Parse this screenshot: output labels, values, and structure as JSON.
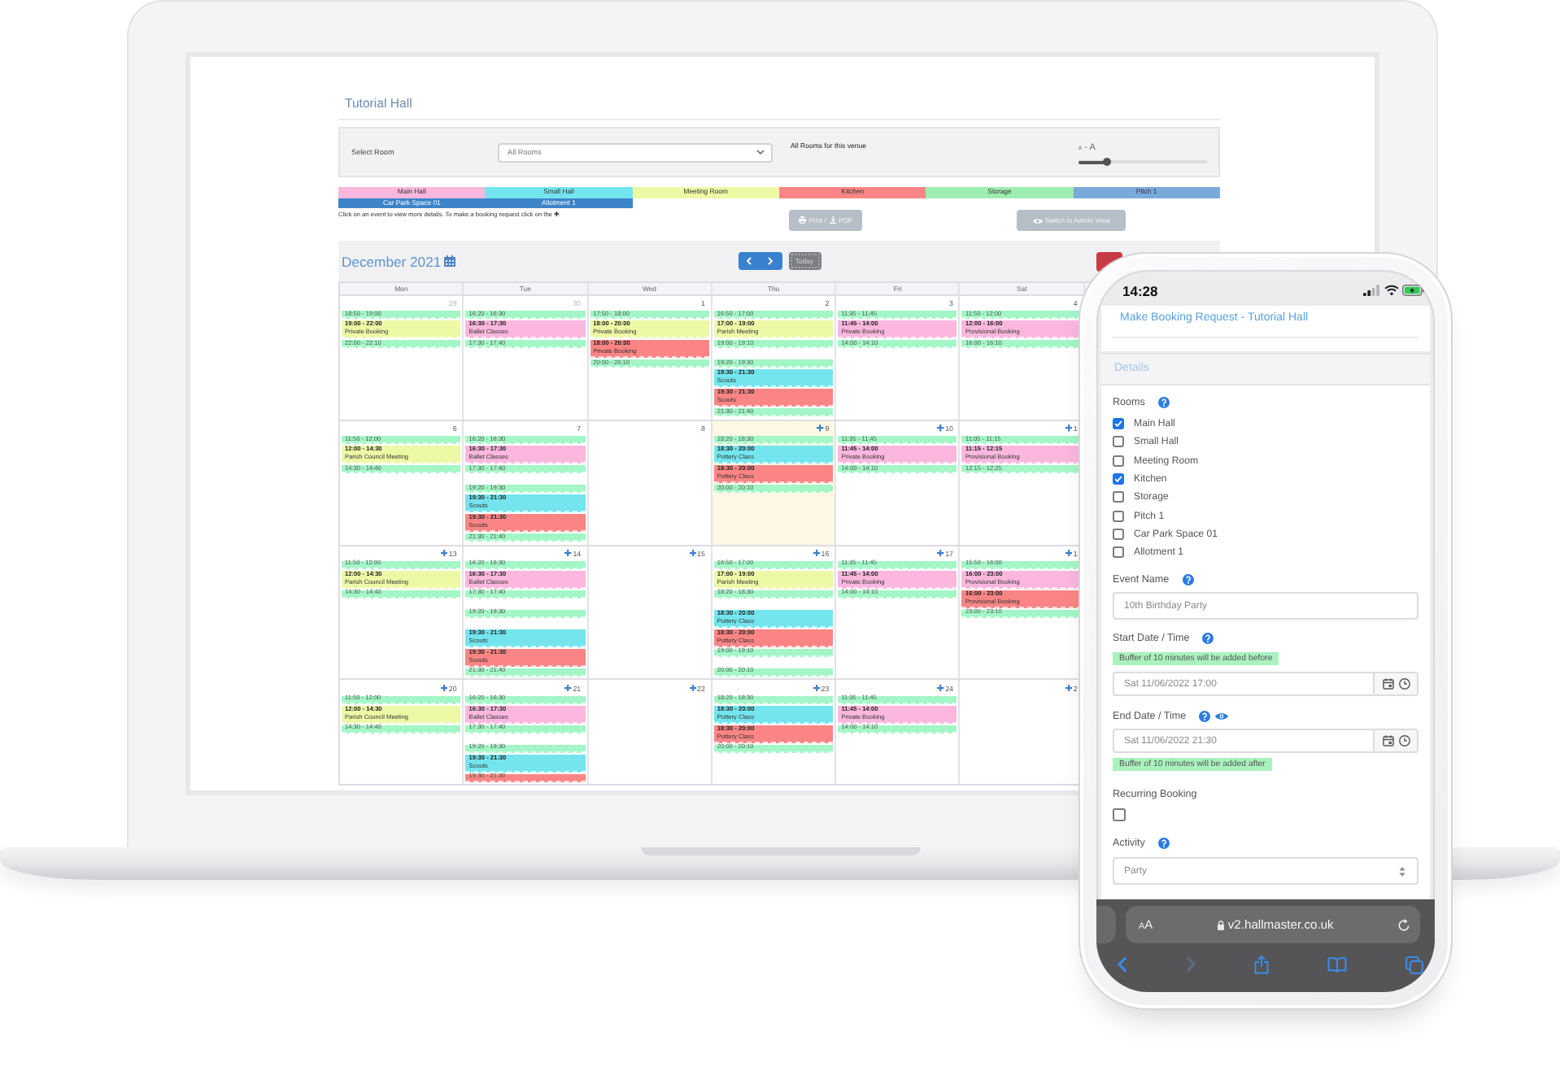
{
  "laptop": {
    "page_title": "Tutorial Hall",
    "filter": {
      "label": "Select Room",
      "select_value": "All Rooms",
      "note": "All Rooms for this venue",
      "slider": {
        "label": "A - A",
        "level": 0.22
      }
    },
    "legend": [
      {
        "name": "Main Hall",
        "color": "#fbb7de"
      },
      {
        "name": "Small Hall",
        "color": "#74e5ee"
      },
      {
        "name": "Meeting Room",
        "color": "#eef9a6"
      },
      {
        "name": "Kitchen",
        "color": "#fb8585"
      },
      {
        "name": "Storage",
        "color": "#9eeeb1"
      },
      {
        "name": "Pitch 1",
        "color": "#7aa9dc"
      },
      {
        "name": "Car Park Space 01",
        "color": "#3d84c9"
      },
      {
        "name": "Allotment 1",
        "color": "#3d84c9"
      }
    ],
    "hint": "Click on an event to view more details. To make a booking request click on the ✚.",
    "print_button": [
      "Print /",
      "PDF"
    ],
    "admin_button": "Switch to Admin View",
    "calendar": {
      "title": "December 2021",
      "today_button": {
        "label": "Today",
        "disabled": true
      },
      "weekdays": [
        "Mon",
        "Tue",
        "Wed",
        "Thu",
        "Fri",
        "Sat"
      ],
      "weeks": [
        {
          "days": [
            {
              "date": "29",
              "other_month": true,
              "today": false,
              "bookable": false,
              "events": [
                {
                  "time": "18:50 - 19:00",
                  "color": "#a3f6c6"
                },
                {
                  "time": "19:00 - 22:00",
                  "title": "Private Booking",
                  "color": "#eef9a6"
                },
                {
                  "time": "22:00 - 22:10",
                  "color": "#a3f6c6"
                }
              ]
            },
            {
              "date": "30",
              "other_month": true,
              "today": false,
              "bookable": false,
              "events": [
                {
                  "time": "16:20 - 16:30",
                  "color": "#a3f6c6"
                },
                {
                  "time": "16:30 - 17:30",
                  "title": "Ballet Classes",
                  "color": "#fbb7de"
                },
                {
                  "time": "17:30 - 17:40",
                  "color": "#a3f6c6"
                }
              ]
            },
            {
              "date": "1",
              "other_month": false,
              "today": false,
              "bookable": false,
              "events": [
                {
                  "time": "17:50 - 18:00",
                  "color": "#a3f6c6"
                },
                {
                  "time": "18:00 - 20:00",
                  "title": "Private Booking",
                  "color": "#eef9a6"
                },
                {
                  "time": "18:00 - 20:00",
                  "title": "Private Booking",
                  "color": "#fb8585"
                },
                {
                  "time": "20:00 - 20:10",
                  "color": "#a3f6c6"
                }
              ]
            },
            {
              "date": "2",
              "other_month": false,
              "today": false,
              "bookable": false,
              "events": [
                {
                  "time": "16:50 - 17:00",
                  "color": "#a3f6c6"
                },
                {
                  "time": "17:00 - 19:00",
                  "title": "Parish Meeting",
                  "color": "#eef9a6"
                },
                {
                  "time": "19:00 - 19:10",
                  "color": "#a3f6c6"
                },
                {
                  "time": "19:20 - 19:30",
                  "color": "#a3f6c6"
                },
                {
                  "time": "19:30 - 21:30",
                  "title": "Scouts",
                  "color": "#74e5ee"
                },
                {
                  "time": "19:30 - 21:30",
                  "title": "Scouts",
                  "color": "#fb8585"
                },
                {
                  "time": "21:30 - 21:40",
                  "color": "#a3f6c6"
                }
              ]
            },
            {
              "date": "3",
              "other_month": false,
              "today": false,
              "bookable": false,
              "events": [
                {
                  "time": "11:35 - 11:45",
                  "color": "#a3f6c6"
                },
                {
                  "time": "11:45 - 14:00",
                  "title": "Private Booking",
                  "color": "#fbb7de"
                },
                {
                  "time": "14:00 - 14:10",
                  "color": "#a3f6c6"
                }
              ]
            },
            {
              "date": "4",
              "other_month": false,
              "today": false,
              "bookable": false,
              "events": [
                {
                  "time": "11:50 - 12:00",
                  "color": "#a3f6c6"
                },
                {
                  "time": "12:00 - 16:00",
                  "title": "Provisional Booking",
                  "color": "#fbb7de"
                },
                {
                  "time": "16:00 - 16:10",
                  "color": "#a3f6c6"
                }
              ]
            }
          ]
        },
        {
          "days": [
            {
              "date": "6",
              "other_month": false,
              "today": false,
              "bookable": false,
              "events": [
                {
                  "time": "11:50 - 12:00",
                  "color": "#a3f6c6"
                },
                {
                  "time": "12:00 - 14:30",
                  "title": "Parish Council Meeting",
                  "color": "#eef9a6"
                },
                {
                  "time": "14:30 - 14:40",
                  "color": "#a3f6c6"
                }
              ]
            },
            {
              "date": "7",
              "other_month": false,
              "today": false,
              "bookable": false,
              "events": [
                {
                  "time": "16:20 - 16:30",
                  "color": "#a3f6c6"
                },
                {
                  "time": "16:30 - 17:30",
                  "title": "Ballet Classes",
                  "color": "#fbb7de"
                },
                {
                  "time": "17:30 - 17:40",
                  "color": "#a3f6c6"
                },
                {
                  "time": "19:20 - 19:30",
                  "color": "#a3f6c6"
                },
                {
                  "time": "19:30 - 21:30",
                  "title": "Scouts",
                  "color": "#74e5ee"
                },
                {
                  "time": "19:30 - 21:30",
                  "title": "Scouts",
                  "color": "#fb8585"
                },
                {
                  "time": "21:30 - 21:40",
                  "color": "#a3f6c6"
                }
              ]
            },
            {
              "date": "8",
              "other_month": false,
              "today": false,
              "bookable": false
            },
            {
              "date": "9",
              "other_month": false,
              "today": true,
              "bookable": true,
              "events": [
                {
                  "time": "18:20 - 18:30",
                  "color": "#a3f6c6"
                },
                {
                  "time": "18:30 - 20:00",
                  "title": "Pottery Class",
                  "color": "#74e5ee"
                },
                {
                  "time": "18:30 - 20:00",
                  "title": "Pottery Class",
                  "color": "#fb8585"
                },
                {
                  "time": "20:00 - 20:10",
                  "color": "#a3f6c6"
                }
              ]
            },
            {
              "date": "10",
              "other_month": false,
              "today": false,
              "bookable": true,
              "events": [
                {
                  "time": "11:35 - 11:45",
                  "color": "#a3f6c6"
                },
                {
                  "time": "11:45 - 14:00",
                  "title": "Private Booking",
                  "color": "#fbb7de"
                },
                {
                  "time": "14:00 - 14:10",
                  "color": "#a3f6c6"
                }
              ]
            },
            {
              "date": "1",
              "other_month": false,
              "today": false,
              "bookable": true,
              "events": [
                {
                  "time": "11:05 - 11:15",
                  "color": "#a3f6c6"
                },
                {
                  "time": "11:15 - 12:15",
                  "title": "Provisional Booking",
                  "color": "#fbb7de"
                },
                {
                  "time": "12:15 - 12:25",
                  "color": "#a3f6c6"
                }
              ]
            }
          ]
        },
        {
          "days": [
            {
              "date": "13",
              "other_month": false,
              "today": false,
              "bookable": true,
              "events": [
                {
                  "time": "11:50 - 12:00",
                  "color": "#a3f6c6"
                },
                {
                  "time": "12:00 - 14:30",
                  "title": "Parish Council Meeting",
                  "color": "#eef9a6"
                },
                {
                  "time": "14:30 - 14:40",
                  "color": "#a3f6c6"
                }
              ]
            },
            {
              "date": "14",
              "other_month": false,
              "today": false,
              "bookable": true,
              "events": [
                {
                  "time": "16:20 - 16:30",
                  "color": "#a3f6c6"
                },
                {
                  "time": "16:30 - 17:30",
                  "title": "Ballet Classes",
                  "color": "#fbb7de"
                },
                {
                  "time": "17:30 - 17:40",
                  "color": "#a3f6c6"
                },
                {
                  "time": "19:20 - 19:30",
                  "color": "#a3f6c6"
                },
                {
                  "time": "19:30 - 21:30",
                  "title": "Scouts",
                  "color": "#74e5ee"
                },
                {
                  "time": "19:30 - 21:30",
                  "title": "Scouts",
                  "color": "#fb8585"
                },
                {
                  "time": "21:30 - 21:40",
                  "color": "#a3f6c6"
                }
              ]
            },
            {
              "date": "15",
              "other_month": false,
              "today": false,
              "bookable": true
            },
            {
              "date": "16",
              "other_month": false,
              "today": false,
              "bookable": true,
              "events": [
                {
                  "time": "16:50 - 17:00",
                  "color": "#a3f6c6"
                },
                {
                  "time": "17:00 - 19:00",
                  "title": "Parish Meeting",
                  "color": "#eef9a6"
                },
                {
                  "time": "18:20 - 18:30",
                  "color": "#a3f6c6"
                },
                {
                  "time": "18:30 - 20:00",
                  "title": "Pottery Class",
                  "color": "#74e5ee"
                },
                {
                  "time": "18:30 - 20:00",
                  "title": "Pottery Class",
                  "color": "#fb8585"
                },
                {
                  "time": "19:00 - 19:10",
                  "color": "#a3f6c6"
                },
                {
                  "time": "20:00 - 20:10",
                  "color": "#a3f6c6"
                }
              ]
            },
            {
              "date": "17",
              "other_month": false,
              "today": false,
              "bookable": true,
              "events": [
                {
                  "time": "11:35 - 11:45",
                  "color": "#a3f6c6"
                },
                {
                  "time": "11:45 - 14:00",
                  "title": "Private Booking",
                  "color": "#fbb7de"
                },
                {
                  "time": "14:00 - 14:10",
                  "color": "#a3f6c6"
                }
              ]
            },
            {
              "date": "1",
              "other_month": false,
              "today": false,
              "bookable": true,
              "events": [
                {
                  "time": "15:50 - 16:00",
                  "color": "#a3f6c6"
                },
                {
                  "time": "16:00 - 23:00",
                  "title": "Provisional Booking",
                  "color": "#fbb7de"
                },
                {
                  "time": "16:00 - 23:00",
                  "title": "Provisional Booking",
                  "color": "#fb8585"
                },
                {
                  "time": "23:00 - 23:10",
                  "color": "#a3f6c6"
                }
              ]
            }
          ]
        },
        {
          "days": [
            {
              "date": "20",
              "other_month": false,
              "today": false,
              "bookable": true,
              "events": [
                {
                  "time": "11:50 - 12:00",
                  "color": "#a3f6c6"
                },
                {
                  "time": "12:00 - 14:30",
                  "title": "Parish Council Meeting",
                  "color": "#eef9a6"
                },
                {
                  "time": "14:30 - 14:40",
                  "color": "#a3f6c6"
                }
              ]
            },
            {
              "date": "21",
              "other_month": false,
              "today": false,
              "bookable": true,
              "events": [
                {
                  "time": "16:20 - 16:30",
                  "color": "#a3f6c6"
                },
                {
                  "time": "16:30 - 17:30",
                  "title": "Ballet Classes",
                  "color": "#fbb7de"
                },
                {
                  "time": "17:30 - 17:40",
                  "color": "#a3f6c6"
                },
                {
                  "time": "19:20 - 19:30",
                  "color": "#a3f6c6"
                },
                {
                  "time": "19:30 - 21:30",
                  "title": "Scouts",
                  "color": "#74e5ee"
                },
                {
                  "time": "19:30 - 21:30",
                  "color": "#fb8585"
                }
              ]
            },
            {
              "date": "22",
              "other_month": false,
              "today": false,
              "bookable": true
            },
            {
              "date": "23",
              "other_month": false,
              "today": false,
              "bookable": true,
              "events": [
                {
                  "time": "18:20 - 18:30",
                  "color": "#a3f6c6"
                },
                {
                  "time": "18:30 - 20:00",
                  "title": "Pottery Class",
                  "color": "#74e5ee"
                },
                {
                  "time": "18:30 - 20:00",
                  "title": "Pottery Class",
                  "color": "#fb8585"
                },
                {
                  "time": "20:00 - 20:10",
                  "color": "#a3f6c6"
                }
              ]
            },
            {
              "date": "24",
              "other_month": false,
              "today": false,
              "bookable": true,
              "events": [
                {
                  "time": "11:35 - 11:45",
                  "color": "#a3f6c6"
                },
                {
                  "time": "11:45 - 14:00",
                  "title": "Private Booking",
                  "color": "#fbb7de"
                },
                {
                  "time": "14:00 - 14:10",
                  "color": "#a3f6c6"
                }
              ]
            },
            {
              "date": "2",
              "other_month": false,
              "today": false,
              "bookable": true
            }
          ]
        }
      ]
    }
  },
  "phone": {
    "time": "14:28",
    "title": "Make Booking Request - Tutorial Hall",
    "section": "Details",
    "rooms_label": "Rooms",
    "rooms": [
      {
        "name": "Main Hall",
        "checked": true
      },
      {
        "name": "Small Hall",
        "checked": false
      },
      {
        "name": "Meeting Room",
        "checked": false
      },
      {
        "name": "Kitchen",
        "checked": true
      },
      {
        "name": "Storage",
        "checked": false
      },
      {
        "name": "Pitch 1",
        "checked": false
      },
      {
        "name": "Car Park Space 01",
        "checked": false
      },
      {
        "name": "Allotment 1",
        "checked": false
      }
    ],
    "event_name": {
      "label": "Event Name",
      "value": "10th Birthday Party"
    },
    "start": {
      "label": "Start Date / Time",
      "note": "Buffer of 10 minutes will be added before",
      "value": "Sat 11/06/2022 17:00"
    },
    "end": {
      "label": "End Date / Time",
      "value": "Sat 11/06/2022 21:30",
      "note": "Buffer of 10 minutes will be added after"
    },
    "recurring": {
      "label": "Recurring Booking",
      "checked": false
    },
    "activity": {
      "label": "Activity",
      "value": "Party"
    },
    "browser": {
      "text_size": "AA",
      "url": "v2.hallmaster.co.uk"
    }
  }
}
